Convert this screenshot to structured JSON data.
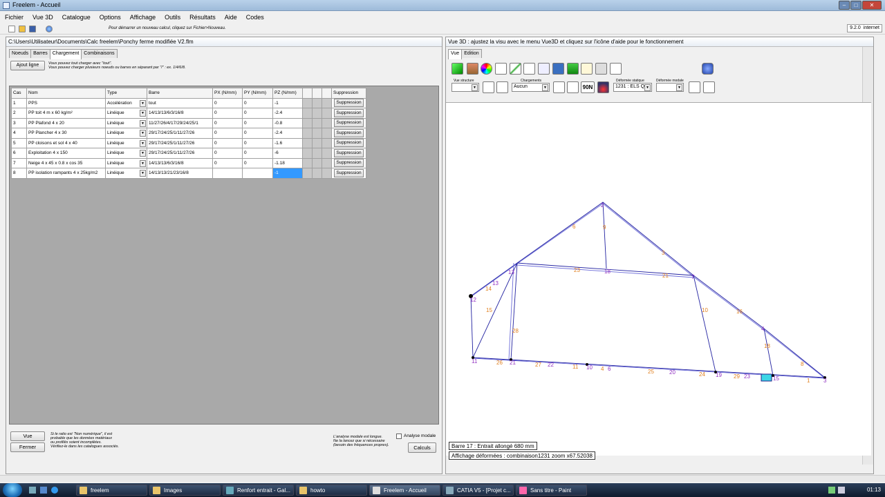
{
  "window": {
    "title": "Freelem - Accueil",
    "version": "9.2.0",
    "version_suffix": "internet"
  },
  "menu": [
    "Fichier",
    "Vue 3D",
    "Catalogue",
    "Options",
    "Affichage",
    "Outils",
    "Résultats",
    "Aide",
    "Codes"
  ],
  "toolbar": {
    "hint": "Pour démarrer un nouveau calcul, cliquez sur Fichier>Nouveau."
  },
  "left": {
    "path": "C:\\Users\\Utilisateur\\Documents\\Calc freelem\\Ponchy ferme modifiée V2.flm",
    "tabs": [
      "Noeuds",
      "Barres",
      "Chargement",
      "Combinaisons"
    ],
    "add_line": "Ajout ligne",
    "add_note_1": "Vous pouvez tout charger avec \"tout\".",
    "add_note_2": "Vous pouvez charger plusieurs noeuds ou barres en séparant par \"/\" : ex. 1/4/6/8.",
    "columns": [
      "Cas",
      "Nom",
      "Type",
      "Barre",
      "PX (N/mm)",
      "PY (N/mm)",
      "PZ (N/mm)",
      "",
      "",
      "",
      "Suppression"
    ],
    "rows": [
      {
        "cas": "1",
        "nom": "PPS",
        "type": "Accélération",
        "barre": "tout",
        "px": "0",
        "py": "0",
        "pz": "-1",
        "sup": "Suppression"
      },
      {
        "cas": "2",
        "nom": "PP toit 4 m x 60 kg/m²",
        "type": "Linéique",
        "barre": "14/13/13/6/3/16/8",
        "px": "0",
        "py": "0",
        "pz": "-2.4",
        "sup": "Suppression"
      },
      {
        "cas": "3",
        "nom": "PP Plafond 4 x  20",
        "type": "Linéique",
        "barre": "11/27/26/4/17/29/24/25/1",
        "px": "0",
        "py": "0",
        "pz": "-0.8",
        "sup": "Suppression"
      },
      {
        "cas": "4",
        "nom": "PP Plancher 4 x 30",
        "type": "Linéique",
        "barre": "29/17/24/25/1/11/27/26",
        "px": "0",
        "py": "0",
        "pz": "-2.4",
        "sup": "Suppression"
      },
      {
        "cas": "5",
        "nom": "PP cloisons et sol 4 x 40",
        "type": "Linéique",
        "barre": "29/17/24/25/1/11/27/26",
        "px": "0",
        "py": "0",
        "pz": "-1.6",
        "sup": "Suppression"
      },
      {
        "cas": "6",
        "nom": "Exploitation 4 x 150",
        "type": "Linéique",
        "barre": "29/17/24/25/1/11/27/26",
        "px": "0",
        "py": "0",
        "pz": "-6",
        "sup": "Suppression"
      },
      {
        "cas": "7",
        "nom": "Neige 4 x 45 x 0.8 x cos 35",
        "type": "Linéique",
        "barre": "14/13/13/6/3/16/8",
        "px": "0",
        "py": "0",
        "pz": "-1.18",
        "sup": "Suppression"
      },
      {
        "cas": "8",
        "nom": "PP isolation rampants 4 x 25kg/m2",
        "type": "Linéique",
        "barre": "14/13/13/21/23/16/8",
        "px": "",
        "py": "",
        "pz": "-1",
        "sup": "Suppression"
      }
    ],
    "vue_btn": "Vue",
    "fermer_btn": "Fermer",
    "ratio_note_1": "Si le ratio est \"Non numérique\", il est",
    "ratio_note_2": "probable que les données matériaux",
    "ratio_note_3": "ou profilés soient incomplètes.",
    "ratio_note_4": "Vérifiez-le dans les catalogues associés.",
    "modal_note_1": "L'analyse modale est longue.",
    "modal_note_2": "Ne la lancez que si nécessaire",
    "modal_note_3": "(besoin des fréquences propres).",
    "modal_label": "Analyse modale",
    "calculs_btn": "Calculs"
  },
  "right": {
    "header": "Vue 3D : ajustez la visu avec le menu Vue3D et cliquez sur l'icône d'aide pour le fonctionnement",
    "tabs": [
      "Vue",
      "Edition"
    ],
    "vue_structure_label": "Vue structure",
    "chargements_label": "Chargements",
    "chargements_value": "Aucun",
    "deformee_statique_label": "Déformée statique",
    "deformee_statique_value": "1231 : ELS Q",
    "deformee_modale_label": "Déformée modale",
    "force_label": "90N",
    "status_bar": "Barre 17 : Entrait allongé  680 mm",
    "status_def": "Affichage déformées : combinaison1231   zoom x67.52038"
  },
  "taskbar": {
    "items": [
      "freelem",
      "Images",
      "Renfort entrait - Gal...",
      "howto",
      "Freelem - Accueil",
      "CATIA V5 - [Projet c...",
      "Sans titre - Paint"
    ],
    "clock": "01:13"
  },
  "colors": {
    "structure": "#2020a0",
    "bar_label": "#e08020",
    "node_label": "#9030c0",
    "selection": "#3399ff"
  }
}
